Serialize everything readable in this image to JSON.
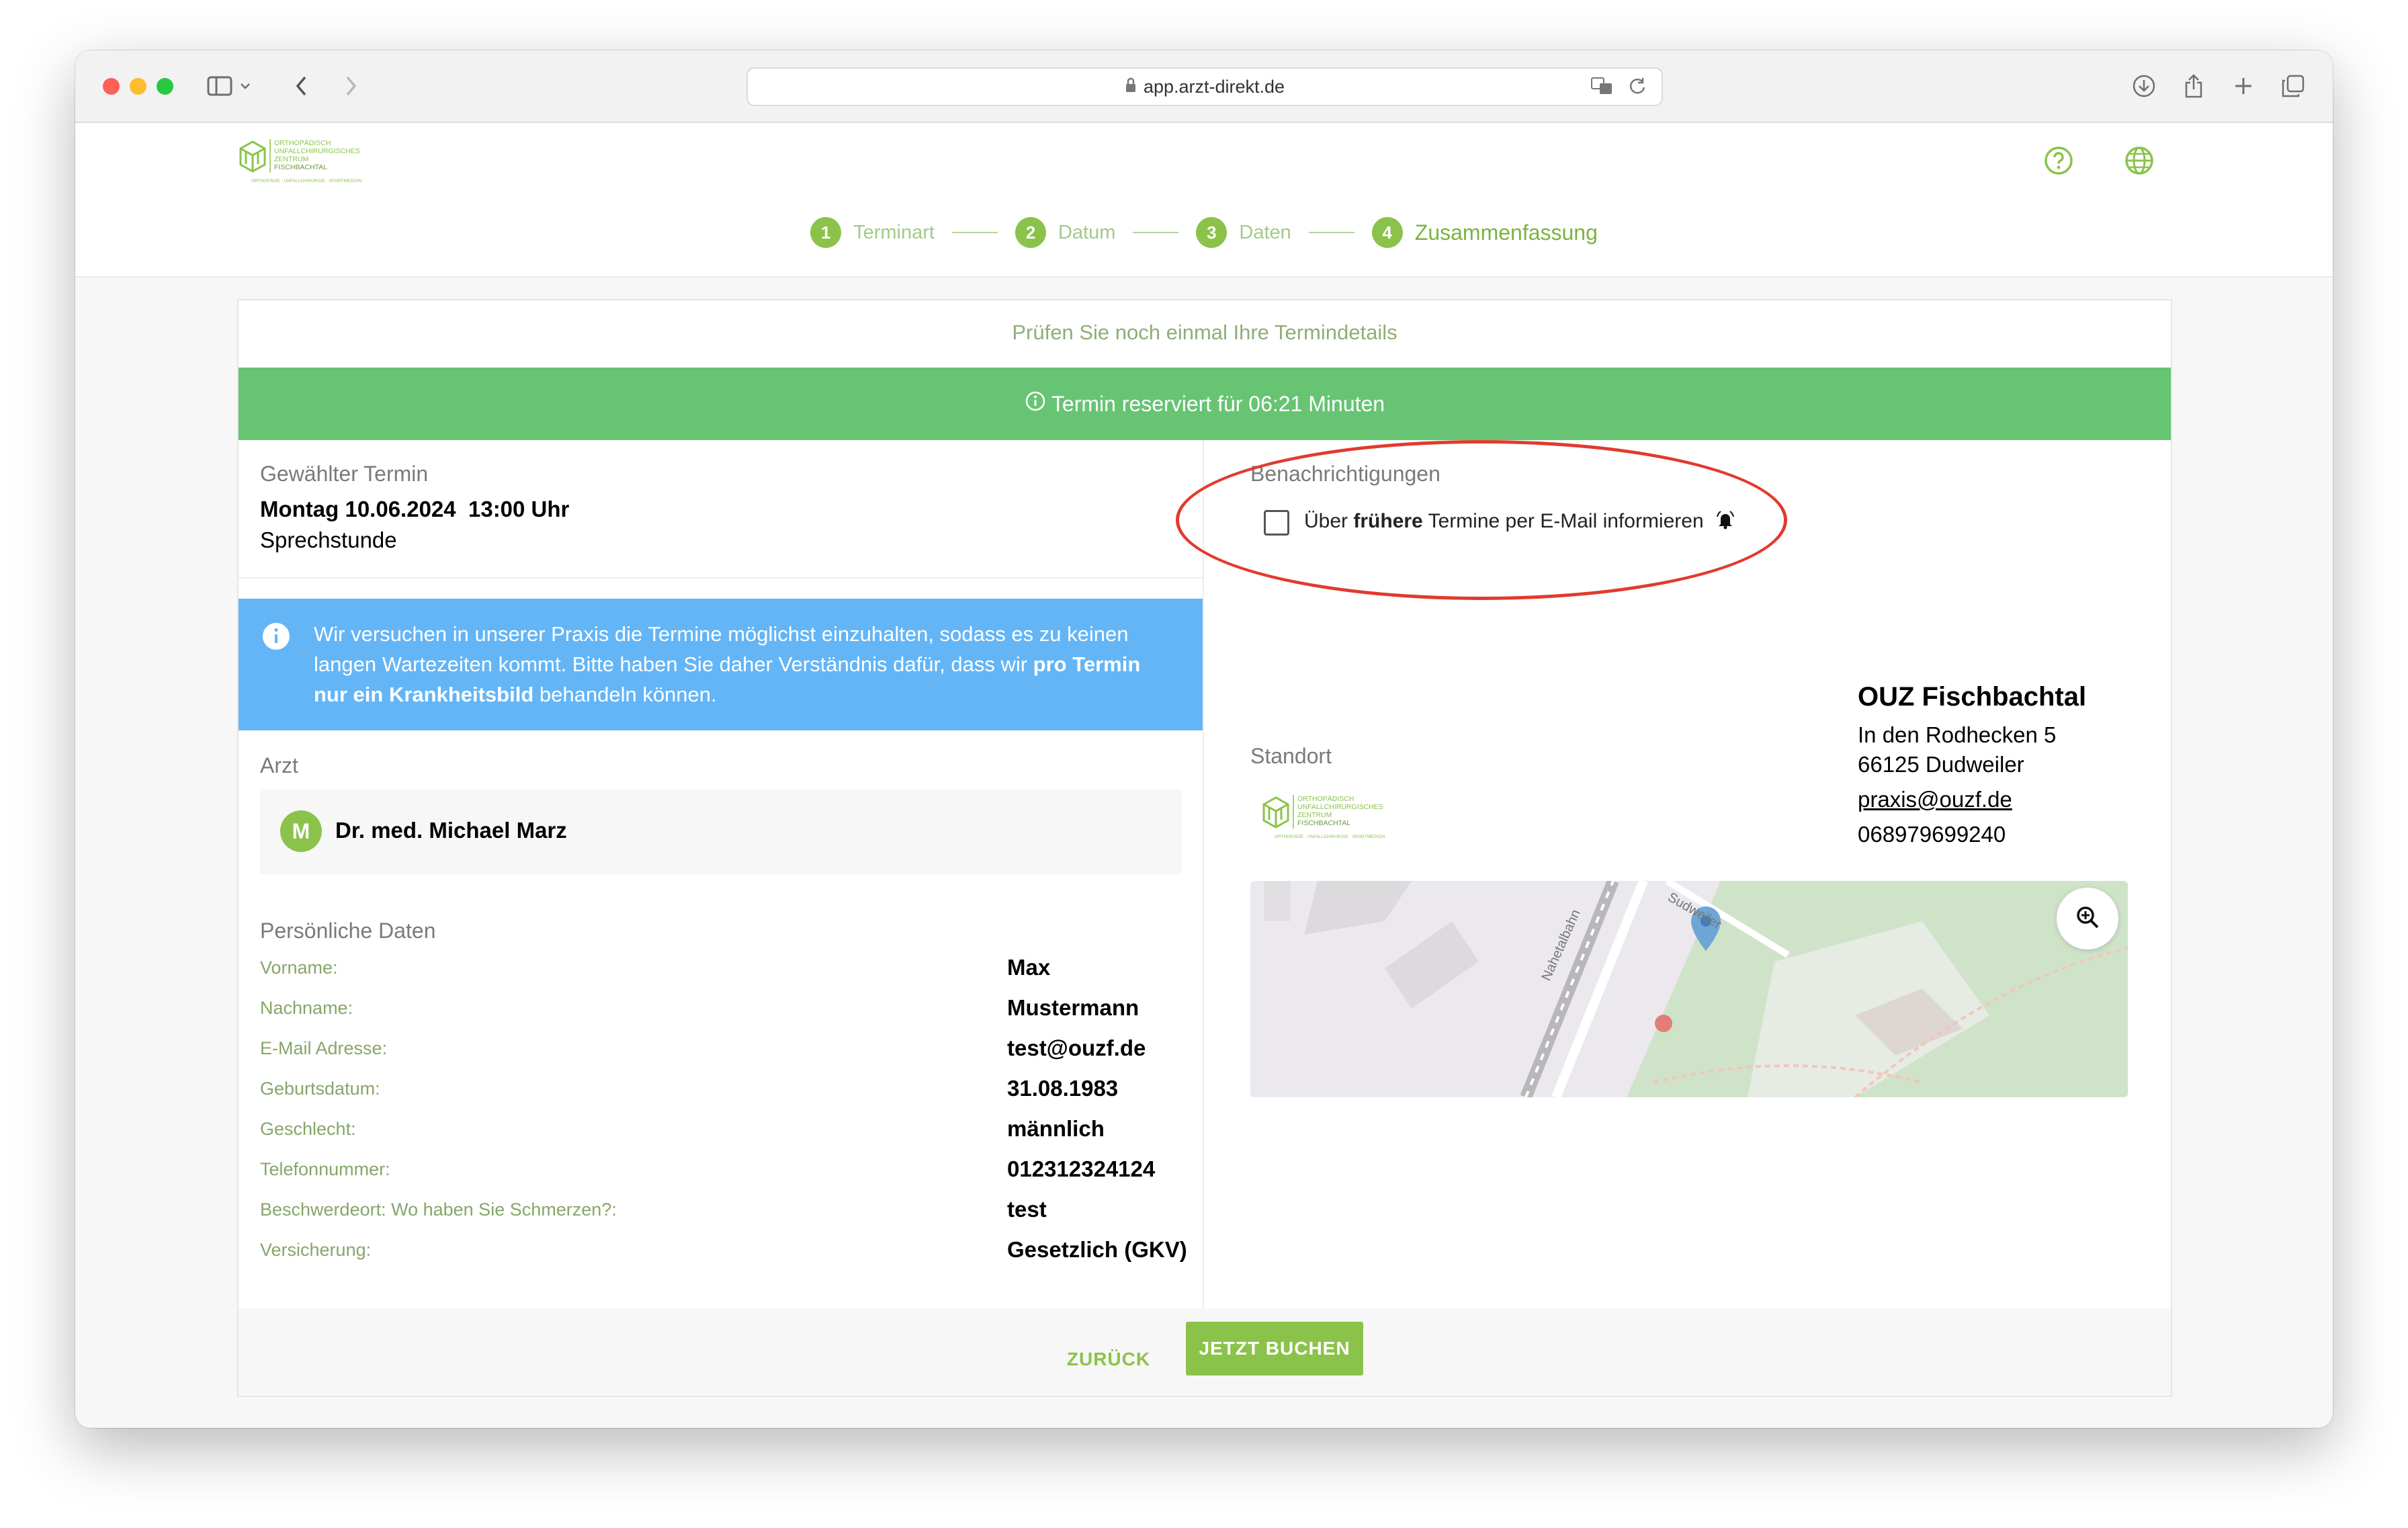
{
  "browser": {
    "url": "app.arzt-direkt.de"
  },
  "header": {
    "logo_lines": [
      "ORTHOPÄDISCH",
      "UNFALLCHIRURGISCHES",
      "ZENTRUM",
      "FISCHBACHTAL",
      "ORTHOPÄDIE · UNFALLCHIRURGIE · SPORTMEDIZIN"
    ],
    "help_icon": "question-circle-icon",
    "language_icon": "globe-icon"
  },
  "stepper": [
    {
      "num": "1",
      "label": "Terminart"
    },
    {
      "num": "2",
      "label": "Datum"
    },
    {
      "num": "3",
      "label": "Daten"
    },
    {
      "num": "4",
      "label": "Zusammenfassung"
    }
  ],
  "card": {
    "title": "Prüfen Sie noch einmal Ihre Termindetails",
    "banner": "Termin reserviert für 06:21 Minuten"
  },
  "termin": {
    "heading": "Gewählter Termin",
    "date": "Montag 10.06.2024",
    "time": "13:00 Uhr",
    "type": "Sprechstunde"
  },
  "info": {
    "text_1": "Wir versuchen in unserer Praxis die Termine möglichst einzuhalten, sodass es zu keinen langen Wartezeiten kommt. Bitte haben Sie daher Verständnis dafür, dass wir ",
    "text_bold": "pro Termin nur ein Krankheitsbild",
    "text_2": " behandeln können."
  },
  "arzt": {
    "heading": "Arzt",
    "initial": "M",
    "name": "Dr. med. Michael Marz"
  },
  "personal": {
    "heading": "Persönliche Daten",
    "rows": [
      {
        "label": "Vorname:",
        "value": "Max"
      },
      {
        "label": "Nachname:",
        "value": "Mustermann"
      },
      {
        "label": "E-Mail Adresse:",
        "value": "test@ouzf.de"
      },
      {
        "label": "Geburtsdatum:",
        "value": "31.08.1983"
      },
      {
        "label": "Geschlecht:",
        "value": "männlich"
      },
      {
        "label": "Telefonnummer:",
        "value": "012312324124"
      },
      {
        "label": "Beschwerdeort: Wo haben Sie Schmerzen?:",
        "value": "test"
      },
      {
        "label": "Versicherung:",
        "value": "Gesetzlich (GKV)"
      }
    ]
  },
  "notifications": {
    "heading": "Benachrichtigungen",
    "text_pre": "Über ",
    "text_bold": "frühere",
    "text_post": " Termine per E-Mail informieren",
    "checked": false
  },
  "standort": {
    "heading": "Standort",
    "name": "OUZ Fischbachtal",
    "street": "In den Rodhecken 5",
    "city": "66125 Dudweiler",
    "email": "praxis@ouzf.de",
    "phone": "068979699240",
    "map_labels": [
      "Nahetalbahn",
      "Sudweiler"
    ]
  },
  "footer": {
    "back_label": "ZURÜCK",
    "book_label": "JETZT BUCHEN"
  },
  "colors": {
    "accent": "#8bc34a",
    "banner": "#67c473",
    "info": "#64b5f6",
    "highlight_ring": "#e23a2e"
  }
}
